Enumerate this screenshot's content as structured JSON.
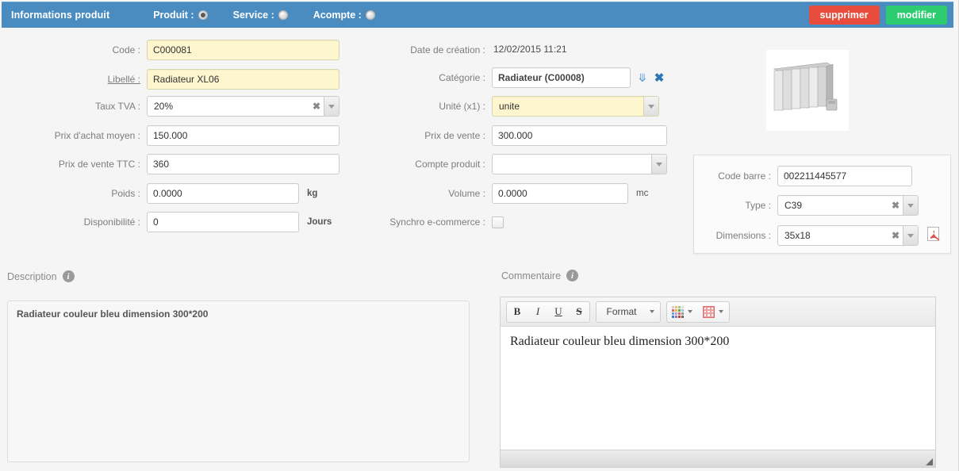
{
  "header": {
    "title": "Informations produit",
    "radios": [
      {
        "label": "Produit :",
        "checked": true
      },
      {
        "label": "Service :",
        "checked": false
      },
      {
        "label": "Acompte :",
        "checked": false
      }
    ],
    "delete_label": "supprimer",
    "edit_label": "modifier",
    "bar_color": "#4a8cc0",
    "delete_color": "#e74c3c",
    "edit_color": "#2ecc71"
  },
  "form": {
    "code": {
      "label": "Code :",
      "value": "C000081"
    },
    "libelle": {
      "label": "Libellé :",
      "value": "Radiateur XL06"
    },
    "taux_tva": {
      "label": "Taux TVA :",
      "value": "20%"
    },
    "prix_achat_moyen": {
      "label": "Prix d'achat moyen :",
      "value": "150.000"
    },
    "prix_vente_ttc": {
      "label": "Prix de vente TTC :",
      "value": "360"
    },
    "poids": {
      "label": "Poids :",
      "value": "0.0000",
      "unit": "kg"
    },
    "disponibilite": {
      "label": "Disponibilité :",
      "value": "0",
      "unit": "Jours"
    },
    "date_creation": {
      "label": "Date de création :",
      "value": "12/02/2015 11:21"
    },
    "categorie": {
      "label": "Catégorie :",
      "value": "Radiateur (C00008)"
    },
    "unite": {
      "label": "Unité (x1) :",
      "value": "unite"
    },
    "prix_vente": {
      "label": "Prix de vente :",
      "value": "300.000"
    },
    "compte_produit": {
      "label": "Compte produit :",
      "value": ""
    },
    "volume": {
      "label": "Volume :",
      "value": "0.0000",
      "unit": "mc"
    },
    "synchro": {
      "label": "Synchro e-commerce :",
      "checked": false
    }
  },
  "barcode": {
    "code_barre": {
      "label": "Code barre :",
      "value": "002211445577"
    },
    "type": {
      "label": "Type :",
      "value": "C39"
    },
    "dimensions": {
      "label": "Dimensions :",
      "value": "35x18"
    }
  },
  "description": {
    "label": "Description",
    "text": "Radiateur couleur bleu dimension 300*200"
  },
  "commentaire": {
    "label": "Commentaire",
    "toolbar": {
      "bold": "B",
      "italic": "I",
      "underline": "U",
      "strike": "S",
      "format": "Format"
    },
    "text": "Radiateur couleur bleu dimension 300*200"
  }
}
